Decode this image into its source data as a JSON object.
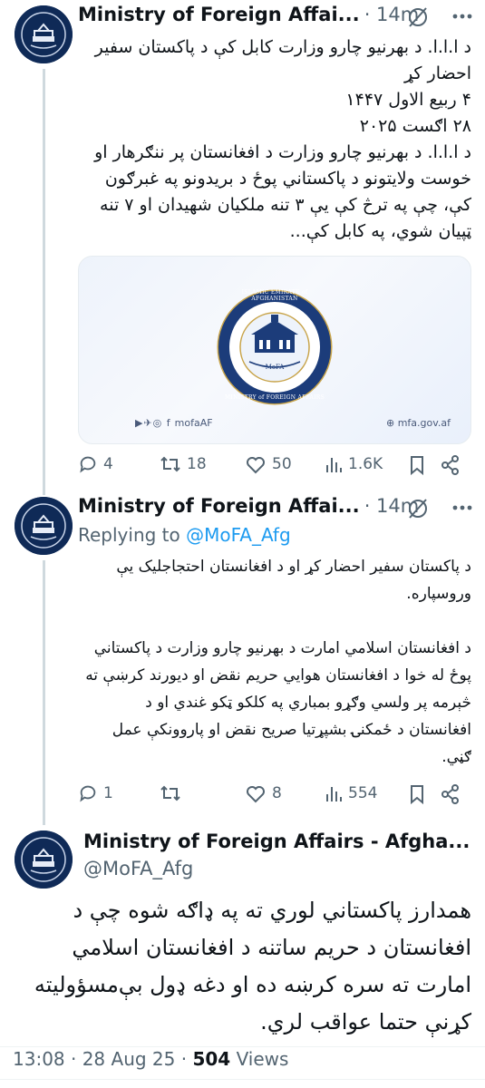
{
  "tweets": [
    {
      "name": "Ministry of Foreign Affai...",
      "time": "14m",
      "paragraphs": [
        "د ا.ا.ا. د بهرنيو چارو وزارت کابل کې د پاکستان سفير احضار کړ",
        "۴ ربيع الاول ۱۴۴۷",
        "۲۸ اګست ۲۰۲۵",
        "د ا.ا.ا. د بهرنيو چارو وزارت د افغانستان پر ننګرهار او خوست ولايتونو د پاکستاني پوځ د بريدونو په غبرګون کې، چې په ترڅ کې يې ۳ تنه ملکيان شهيدان او ۷ تنه ټپيان شوي، په کابل کې..."
      ],
      "card": {
        "seal_top_text": "ISLAMIC EMIRATE of AFGHANISTAN",
        "seal_bottom_text": "MINISTRY of FOREIGN AFFAIRS",
        "seal_center_text": "MoFA",
        "social_handle": "mofaAF",
        "website": "mfa.gov.af"
      },
      "stats": {
        "replies": "4",
        "reposts": "18",
        "likes": "50",
        "views": "1.6K"
      }
    },
    {
      "name": "Ministry of Foreign Affai...",
      "time": "14m",
      "replying_label": "Replying to",
      "replying_handle": "@MoFA_Afg",
      "paragraphs": [
        "د پاکستان سفير احضار کړ او د افغانستان احتجاجليک يې وروسپاره.",
        "د افغانستان اسلامي امارت د بهرنيو چارو وزارت د پاکستاني پوځ له خوا د افغانستان هوايي حريم نقض او ديورند کرښې ته څېرمه پر ولسي وګړو بمباري په کلکو ټکو غندي او د افغانستان د ځمکنۍ بشپړتيا صريح نقض او پاروونکې عمل ګڼي."
      ],
      "stats": {
        "replies": "1",
        "reposts": "",
        "likes": "8",
        "views": "554"
      }
    },
    {
      "name": "Ministry of Foreign Affairs - Afgha...",
      "handle": "@MoFA_Afg",
      "paragraphs": [
        "همدارز پاکستاني لوري ته په ډاګه شوه چې د افغانستان د حريم ساتنه د افغانستان اسلامي امارت ته سره کرښه ده او دغه ډول بې‌مسؤوليته کړنې حتما عواقب لري."
      ],
      "footer_time": "13:08 · 28 Aug 25 ·",
      "footer_views_count": "504",
      "footer_views_label": "Views"
    }
  ],
  "colors": {
    "text": "#0f1419",
    "secondary": "#536471",
    "accent": "#1d9bf0",
    "line": "#cfd9de"
  },
  "icons": [
    "grok-icon",
    "more-icon",
    "reply-icon",
    "repost-icon",
    "like-icon",
    "views-icon",
    "bookmark-icon",
    "share-icon"
  ]
}
